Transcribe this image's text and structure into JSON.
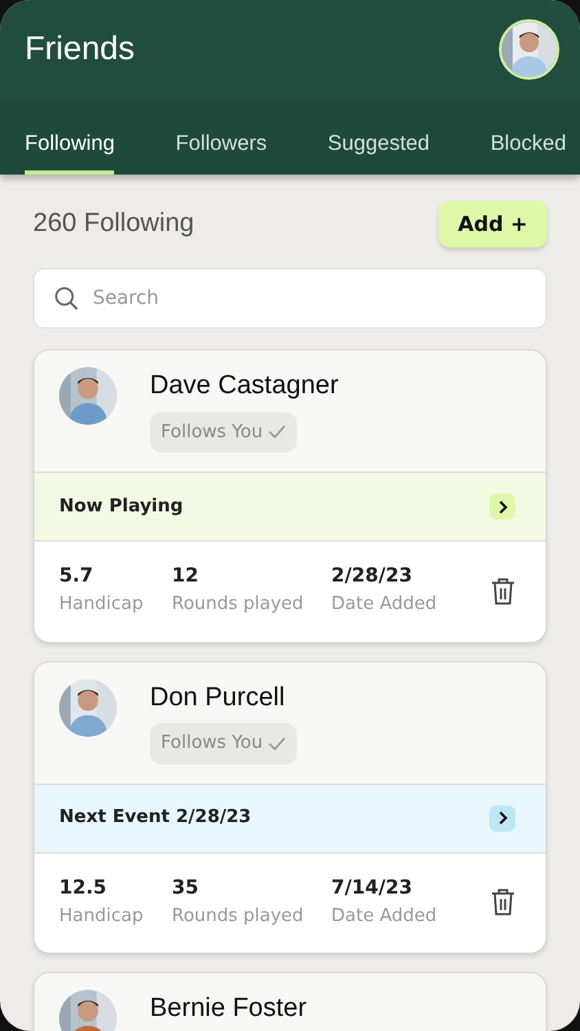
{
  "header": {
    "title": "Friends"
  },
  "tabs": [
    {
      "label": "Following",
      "selected": true
    },
    {
      "label": "Followers",
      "selected": false
    },
    {
      "label": "Suggested",
      "selected": false
    },
    {
      "label": "Blocked",
      "selected": false
    }
  ],
  "summary": {
    "count": "260 Following",
    "add_button": "Add +"
  },
  "search": {
    "placeholder": "Search"
  },
  "friends": [
    {
      "name": "Dave Castagner",
      "badge": "Follows You",
      "banner": {
        "kind": "playing",
        "text": "Now Playing"
      },
      "stats": [
        {
          "value": "5.7",
          "label": "Handicap"
        },
        {
          "value": "12",
          "label": "Rounds played"
        },
        {
          "value": "2/28/23",
          "label": "Date Added"
        }
      ]
    },
    {
      "name": "Don Purcell",
      "badge": "Follows You",
      "banner": {
        "kind": "event",
        "text": "Next Event 2/28/23"
      },
      "stats": [
        {
          "value": "12.5",
          "label": "Handicap"
        },
        {
          "value": "35",
          "label": "Rounds played"
        },
        {
          "value": "7/14/23",
          "label": "Date Added"
        }
      ]
    },
    {
      "name": "Bernie Foster"
    }
  ]
}
